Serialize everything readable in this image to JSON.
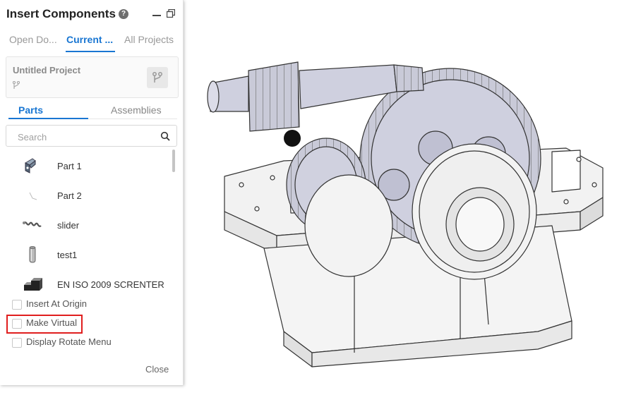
{
  "panel": {
    "title": "Insert Components",
    "tabs": [
      "Open Do...",
      "Current ...",
      "All Projects"
    ],
    "project": {
      "title": "Untitled Project"
    },
    "subtabs": [
      "Parts",
      "Assemblies"
    ],
    "search": {
      "placeholder": "Search",
      "value": ""
    },
    "parts": [
      {
        "label": "Part 1",
        "icon": "bracket-part-icon"
      },
      {
        "label": "Part 2",
        "icon": "line-sketch-icon"
      },
      {
        "label": "slider",
        "icon": "spring-slider-icon"
      },
      {
        "label": "test1",
        "icon": "cylinder-part-icon"
      },
      {
        "label": "EN ISO 2009 SCRENTER",
        "icon": "step-block-icon"
      }
    ],
    "options": [
      {
        "label": "Insert At Origin",
        "checked": false
      },
      {
        "label": "Make Virtual",
        "checked": false
      },
      {
        "label": "Display Rotate Menu",
        "checked": false
      }
    ],
    "close_label": "Close"
  },
  "colors": {
    "accent": "#1976d2",
    "highlight": "#e01e1e"
  },
  "viewport": {
    "model": "gearbox-assembly"
  }
}
